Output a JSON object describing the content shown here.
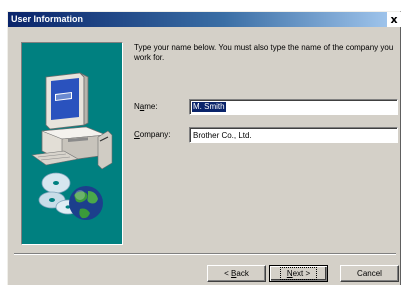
{
  "window": {
    "title": "User Information",
    "close_glyph": "x"
  },
  "instructions": "Type your name below. You must also type the name of the company you work for.",
  "fields": {
    "name": {
      "label_accel": "a",
      "label_pre": "N",
      "label_post": "me:",
      "value": "M. Smith"
    },
    "company": {
      "label_accel": "C",
      "label_pre": "",
      "label_post": "ompany:",
      "value": "Brother Co., Ltd."
    }
  },
  "buttons": {
    "back": {
      "arrow": "< ",
      "accel": "B",
      "rest": "ack"
    },
    "next": {
      "accel": "N",
      "rest": "ext",
      "arrow": " >"
    },
    "cancel": {
      "label": "Cancel"
    }
  },
  "art": {
    "icons": [
      "computer-icon",
      "cd-disc-icon",
      "globe-icon"
    ],
    "background": "#008080"
  }
}
